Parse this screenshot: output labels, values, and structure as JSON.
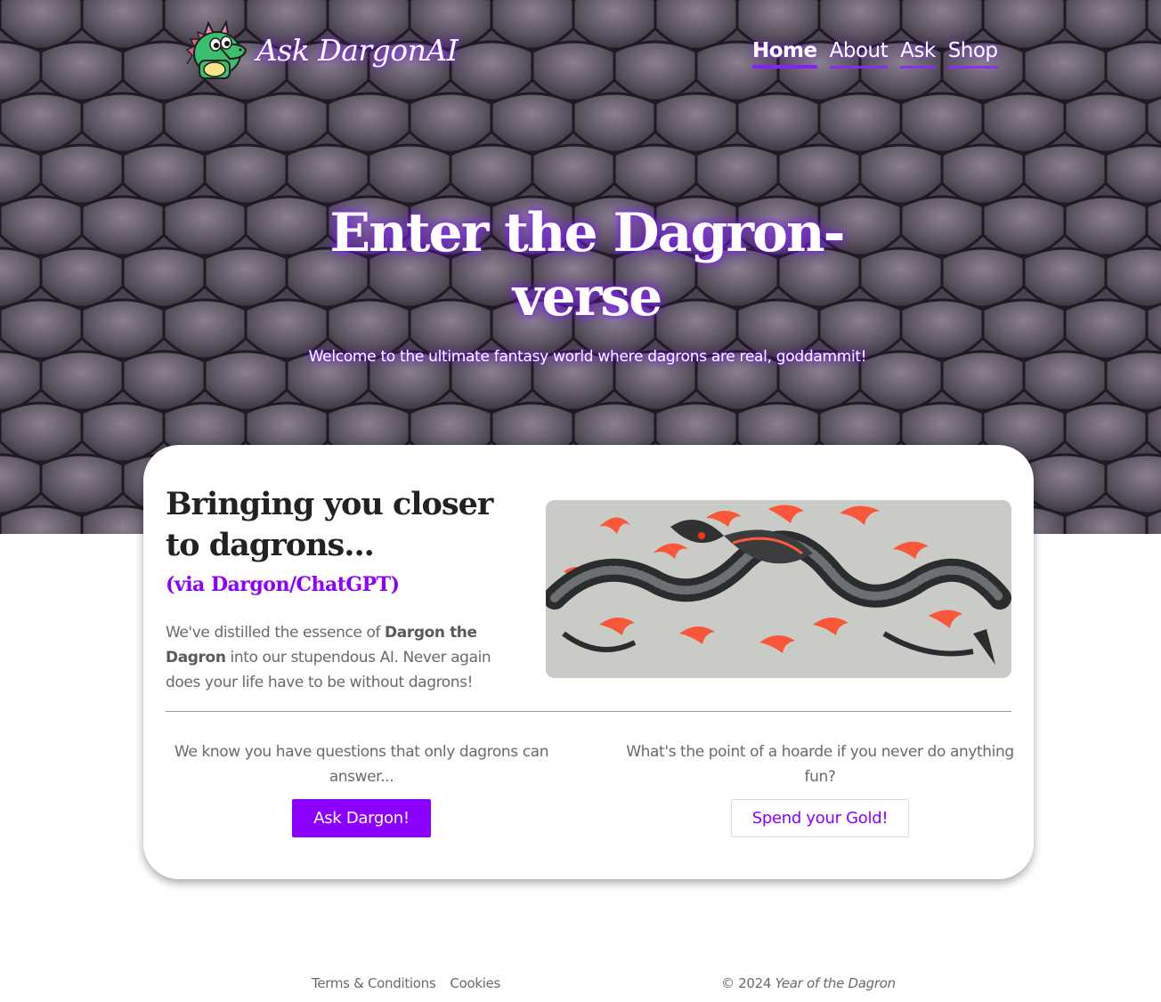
{
  "header": {
    "logo_text": "Ask DargonAI",
    "nav": [
      {
        "label": "Home",
        "active": true
      },
      {
        "label": "About",
        "active": false
      },
      {
        "label": "Ask",
        "active": false
      },
      {
        "label": "Shop",
        "active": false
      }
    ]
  },
  "hero": {
    "title": "Enter the Dagron-verse",
    "subtitle": "Welcome to the ultimate fantasy world where dagrons are real, goddammit!"
  },
  "card": {
    "title": "Bringing you closer to dagrons...",
    "subtitle": "(via Dargon/ChatGPT)",
    "body_part1": "We've distilled the essence of ",
    "body_bold": "Dargon the Dagron",
    "body_part2": " into our stupendous AI. Never again does your life have to be without dagrons!",
    "left_text": "We know you have questions that only dagrons can answer...",
    "left_button": "Ask Dargon!",
    "right_text": "What's the point of a hoarde if you never do anything fun?",
    "right_button": "Spend your Gold!"
  },
  "footer": {
    "links": [
      "Terms & Conditions",
      "Cookies"
    ],
    "copyright_prefix": "© 2024 ",
    "copyright_italic": "Year of the Dagron"
  },
  "colors": {
    "accent": "#8b00ff",
    "hero_glow": "#8c28ff",
    "text_muted": "#6a6a6a",
    "heading": "#222222"
  },
  "icons": {
    "logo": "dragon-mascot-icon",
    "card_image": "dragon-painting-image"
  }
}
